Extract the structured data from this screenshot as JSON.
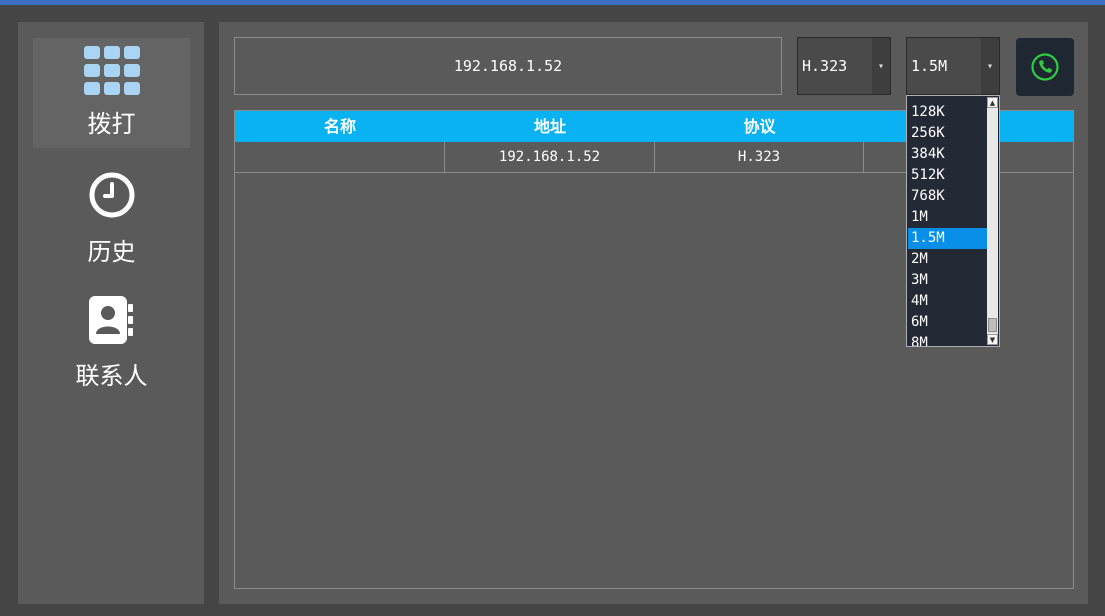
{
  "sidebar": {
    "items": [
      {
        "label": "拨打",
        "icon": "dialpad-icon",
        "active": true
      },
      {
        "label": "历史",
        "icon": "clock-icon",
        "active": false
      },
      {
        "label": "联系人",
        "icon": "contact-book-icon",
        "active": false
      }
    ]
  },
  "dial": {
    "address_value": "192.168.1.52",
    "protocol_value": "H.323",
    "bandwidth_value": "1.5M",
    "call_icon": "phone-icon"
  },
  "table": {
    "headers": [
      "名称",
      "地址",
      "协议",
      ""
    ],
    "rows": [
      [
        "",
        "192.168.1.52",
        "H.323",
        ""
      ]
    ]
  },
  "bandwidth_dropdown": {
    "options": [
      "128K",
      "256K",
      "384K",
      "512K",
      "768K",
      "1M",
      "1.5M",
      "2M",
      "3M",
      "4M",
      "6M",
      "8M"
    ],
    "selected": "1.5M"
  },
  "colors": {
    "accent": "#0ab2f2",
    "call_icon": "#2ecc40",
    "selection": "#0a8fe8"
  }
}
